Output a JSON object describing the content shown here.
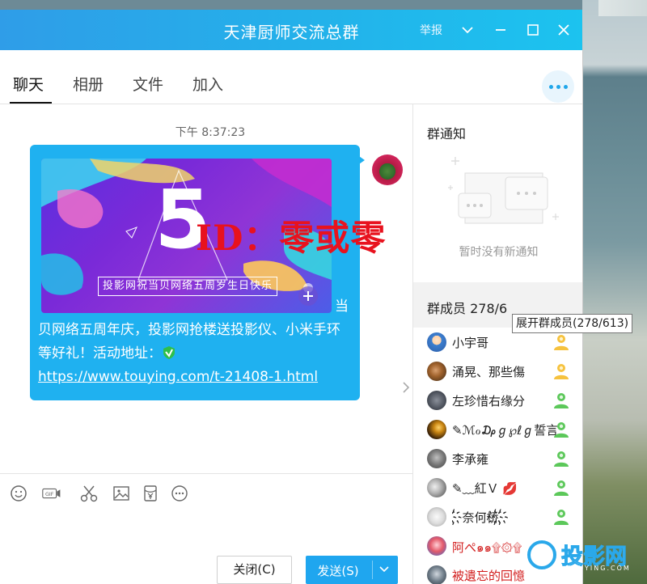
{
  "window": {
    "title": "天津厨师交流总群",
    "report_label": "举报"
  },
  "tabs": [
    {
      "label": "聊天",
      "active": true
    },
    {
      "label": "相册",
      "active": false
    },
    {
      "label": "文件",
      "active": false
    },
    {
      "label": "加入",
      "active": false
    }
  ],
  "chat": {
    "timestamp": "下午 8:37:23",
    "banner_caption": "投影网祝当贝网络五周岁生日快乐",
    "banner_number": "5",
    "watermark": "ID：零或零",
    "message_line1_tail": "当",
    "message_line2": "贝网络五周年庆，投影网抢楼送投影仪、小米手环",
    "message_line3": "等好礼！活动地址：",
    "message_link": "https://www.touying.com/t-21408-1.html"
  },
  "toolbar": {
    "tools": [
      "emoji-icon",
      "gif-icon",
      "scissors-icon",
      "image-icon",
      "red-packet-icon",
      "more-icon"
    ]
  },
  "buttons": {
    "close": "关闭(C)",
    "send": "发送(S)"
  },
  "side": {
    "notice_title": "群通知",
    "notice_empty": "暂时没有新通知",
    "members_title": "群成员 278/6",
    "members_tooltip": "展开群成员(278/613)",
    "members": [
      {
        "name": "小宇哥",
        "red": false,
        "role": "owner"
      },
      {
        "name": "涌晃、那些傷",
        "red": false,
        "role": "owner"
      },
      {
        "name": "左珍惜右缘分",
        "red": false,
        "role": "admin"
      },
      {
        "name": "✎ℳℴ₯ℊ℘ℓℊ誓言",
        "red": false,
        "role": "admin"
      },
      {
        "name": "李承雍",
        "red": false,
        "role": "admin"
      },
      {
        "name": "✎﹏紅Ｖ 💋",
        "red": false,
        "role": "admin"
      },
      {
        "name": "҉҉奈何桥҉҉",
        "red": false,
        "role": "admin"
      },
      {
        "name": "阿ぺ๑๑۩۞۩",
        "red": true,
        "role": "none"
      },
      {
        "name": "被遺忘的回憶",
        "red": true,
        "role": "none"
      }
    ]
  },
  "logo": {
    "text": "投影网",
    "sub": "TOUYING.COM"
  },
  "colors": {
    "accent": "#1fa6ef",
    "bubble": "#1fb1f0",
    "watermark": "#e8121e"
  }
}
